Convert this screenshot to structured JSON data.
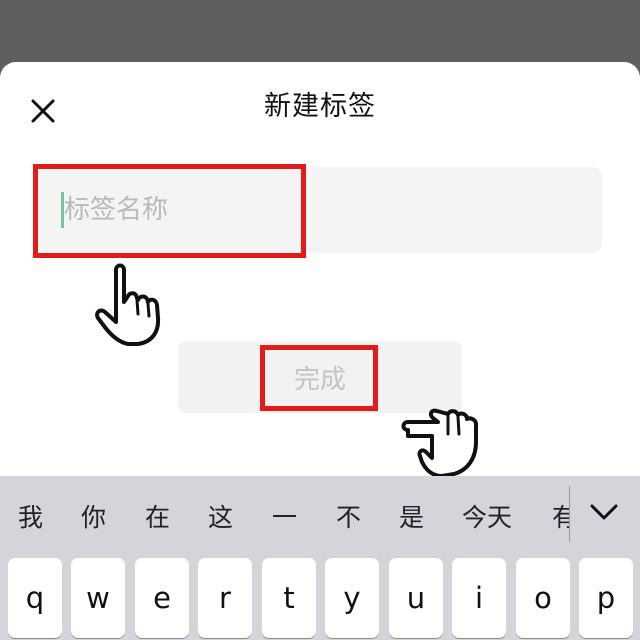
{
  "dialog": {
    "title": "新建标签",
    "input_placeholder": "标签名称",
    "input_value": "",
    "done_label": "完成"
  },
  "keyboard": {
    "candidates": [
      "我",
      "你",
      "在",
      "这",
      "一",
      "不",
      "是",
      "今天",
      "有"
    ],
    "keys_row1": [
      "q",
      "w",
      "e",
      "r",
      "t",
      "y",
      "u",
      "i",
      "o",
      "p"
    ]
  },
  "icons": {
    "close": "close-icon",
    "collapse": "chevron-down-icon",
    "pointer": "pointing-hand-icon"
  },
  "colors": {
    "highlight": "#e31b1b",
    "caret": "#7ac29a",
    "field_bg": "#f4f4f4",
    "keyboard_bg": "#d3d5db"
  }
}
